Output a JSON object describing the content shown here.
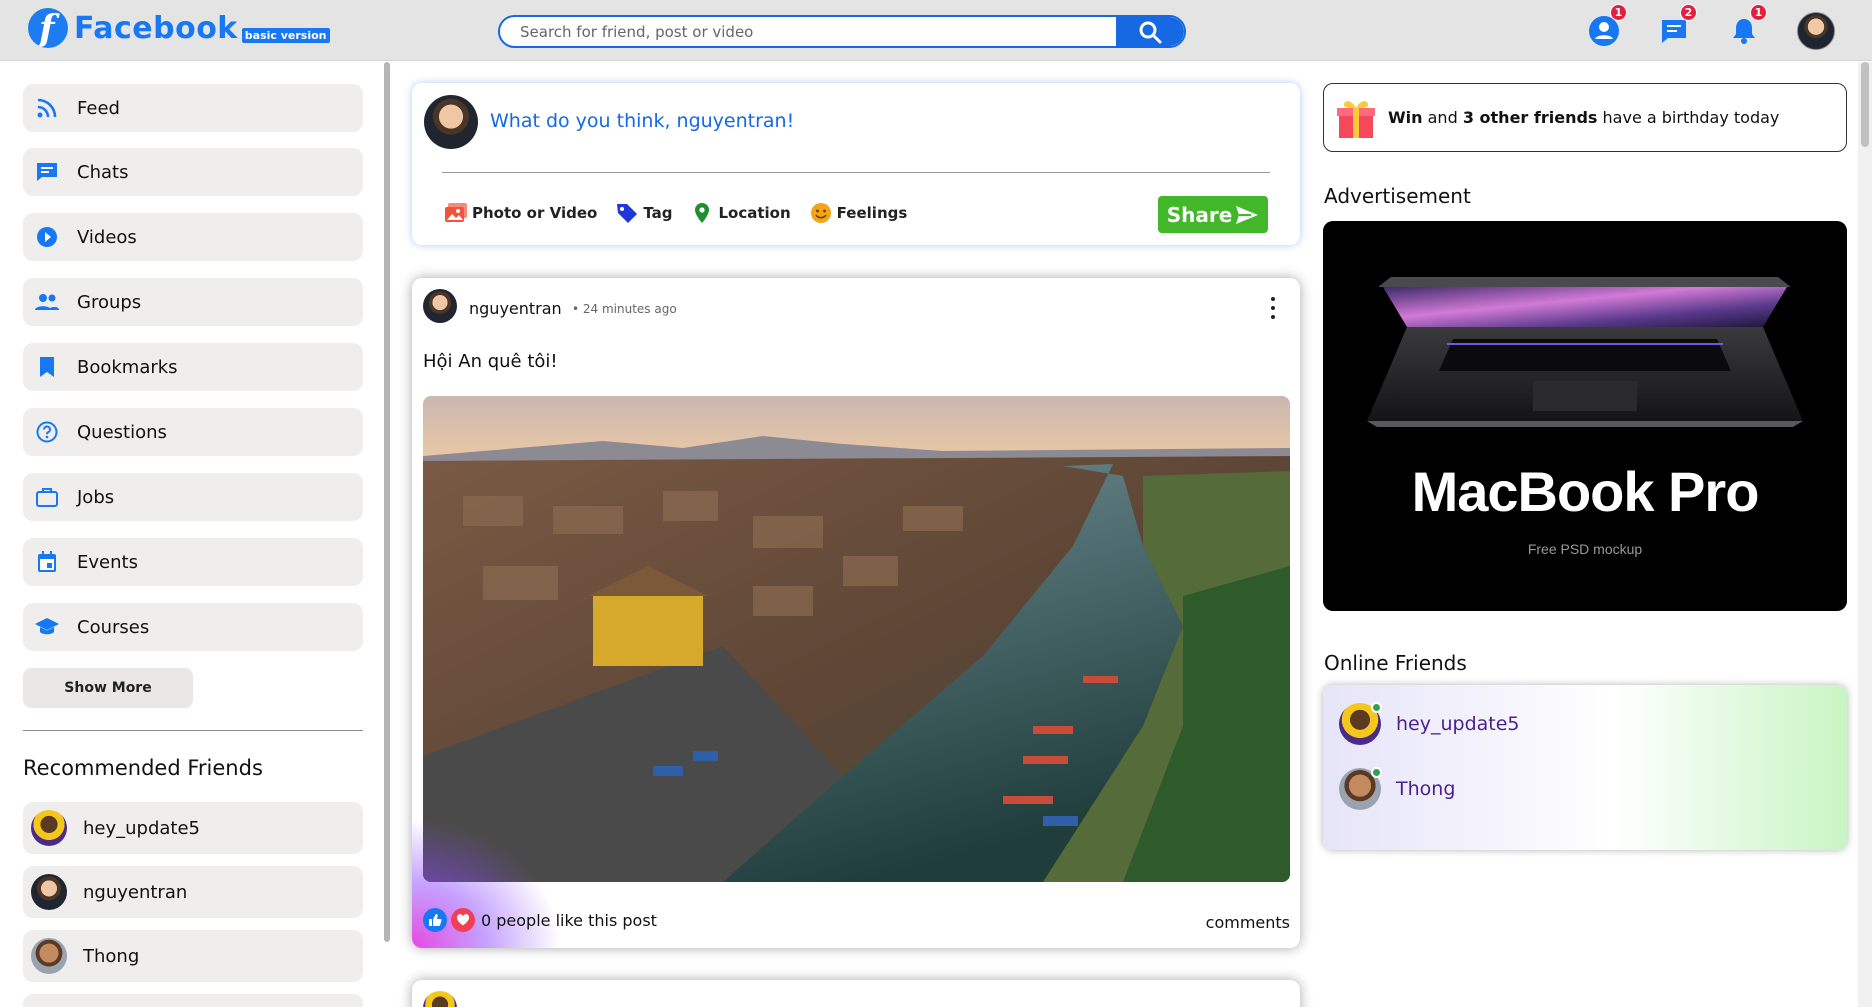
{
  "header": {
    "logo_letter": "f",
    "logo_text": "Facebook",
    "logo_badge": "basic version",
    "search_placeholder": "Search for friend, post or video",
    "notifications": {
      "friends": "1",
      "messages": "2",
      "alerts": "1"
    }
  },
  "sidebar": {
    "items": [
      {
        "label": "Feed",
        "icon": "rss-icon"
      },
      {
        "label": "Chats",
        "icon": "chat-icon"
      },
      {
        "label": "Videos",
        "icon": "play-circle-icon"
      },
      {
        "label": "Groups",
        "icon": "group-icon"
      },
      {
        "label": "Bookmarks",
        "icon": "bookmark-icon"
      },
      {
        "label": "Questions",
        "icon": "question-icon"
      },
      {
        "label": "Jobs",
        "icon": "briefcase-icon"
      },
      {
        "label": "Events",
        "icon": "calendar-icon"
      },
      {
        "label": "Courses",
        "icon": "graduation-cap-icon"
      }
    ],
    "show_more": "Show More",
    "recommended_title": "Recommended Friends",
    "recommended": [
      {
        "name": "hey_update5"
      },
      {
        "name": "nguyentran"
      },
      {
        "name": "Thong"
      }
    ]
  },
  "composer": {
    "prompt": "What do you think, nguyentran!",
    "options": [
      {
        "label": "Photo or Video",
        "icon": "photo-icon",
        "color": "#f3533d"
      },
      {
        "label": "Tag",
        "icon": "tag-icon",
        "color": "#1e37d6"
      },
      {
        "label": "Location",
        "icon": "location-pin-icon",
        "color": "#1f8f2f"
      },
      {
        "label": "Feelings",
        "icon": "smile-icon",
        "color": "#f2a516"
      }
    ],
    "share_label": "Share"
  },
  "post": {
    "author": "nguyentran",
    "time": "• 24 minutes ago",
    "text": "Hội An quê tôi!",
    "likes_text": "0 people like this post",
    "comments_label": "comments"
  },
  "right": {
    "birthday": {
      "name": "Win",
      "middle": "and",
      "others": "3 other friends",
      "rest": "have a birthday today"
    },
    "ad_title": "Advertisement",
    "ad_product": "MacBook Pro",
    "ad_sub": "Free PSD mockup",
    "online_title": "Online Friends",
    "online": [
      {
        "name": "hey_update5"
      },
      {
        "name": "Thong"
      }
    ]
  },
  "colors": {
    "brand": "#1877f2",
    "search_accent": "#1668e3",
    "share_button": "#42b72a",
    "badge": "#e41e3f",
    "online_dot": "#31a24c"
  }
}
